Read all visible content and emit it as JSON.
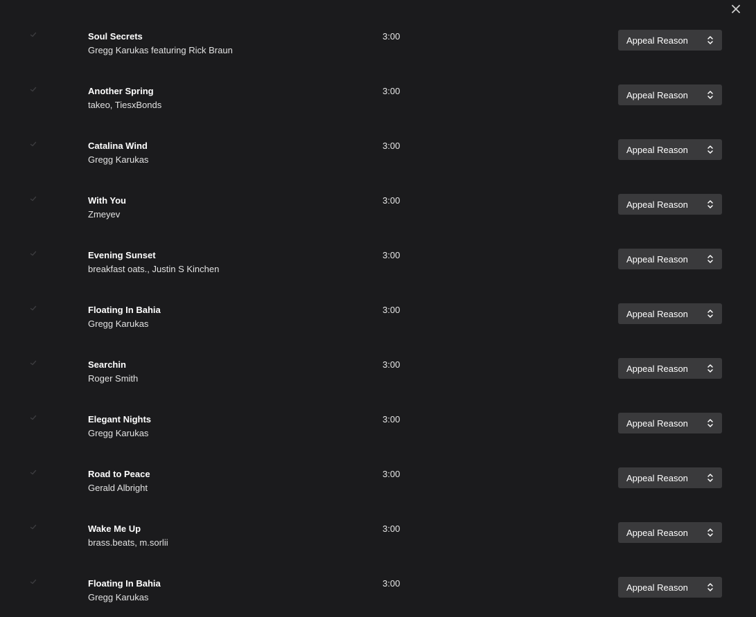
{
  "close_icon": "close-icon",
  "select_icon": "chevron-up-down-icon",
  "colors": {
    "background": "#1b1b1d",
    "select_bg": "#3a3a3c",
    "check": "#3c3c3f"
  },
  "tracks": [
    {
      "title": "Soul Secrets",
      "artist": "Gregg Karukas featuring Rick Braun",
      "duration": "3:00",
      "appeal": "Appeal Reason"
    },
    {
      "title": "Another Spring",
      "artist": "takeo, TiesxBonds",
      "duration": "3:00",
      "appeal": "Appeal Reason"
    },
    {
      "title": "Catalina Wind",
      "artist": "Gregg Karukas",
      "duration": "3:00",
      "appeal": "Appeal Reason"
    },
    {
      "title": "With You",
      "artist": "Zmeyev",
      "duration": "3:00",
      "appeal": "Appeal Reason"
    },
    {
      "title": "Evening Sunset",
      "artist": "breakfast oats., Justin S Kinchen",
      "duration": "3:00",
      "appeal": "Appeal Reason"
    },
    {
      "title": "Floating In Bahia",
      "artist": "Gregg Karukas",
      "duration": "3:00",
      "appeal": "Appeal Reason"
    },
    {
      "title": "Searchin",
      "artist": "Roger Smith",
      "duration": "3:00",
      "appeal": "Appeal Reason"
    },
    {
      "title": "Elegant Nights",
      "artist": "Gregg Karukas",
      "duration": "3:00",
      "appeal": "Appeal Reason"
    },
    {
      "title": "Road to Peace",
      "artist": "Gerald Albright",
      "duration": "3:00",
      "appeal": "Appeal Reason"
    },
    {
      "title": "Wake Me Up",
      "artist": "brass.beats, m.sorlii",
      "duration": "3:00",
      "appeal": "Appeal Reason"
    },
    {
      "title": "Floating In Bahia",
      "artist": "Gregg Karukas",
      "duration": "3:00",
      "appeal": "Appeal Reason"
    }
  ]
}
